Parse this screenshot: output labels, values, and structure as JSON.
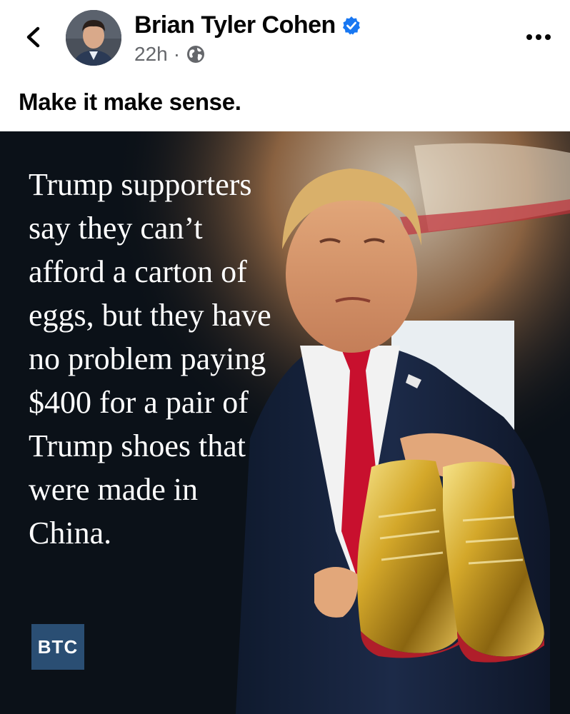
{
  "header": {
    "author_name": "Brian Tyler Cohen",
    "timestamp": "22h",
    "separator": "·",
    "verified": true,
    "audience_icon": "globe-icon",
    "back_icon": "chevron-left-icon",
    "more_icon": "more-horizontal-icon"
  },
  "post": {
    "caption": "Make it make sense.",
    "image": {
      "overlay_text": "Trump supporters\nsay they can’t\nafford a carton of\neggs, but they have\nno problem paying\n$400 for a pair of\nTrump shoes that\nwere made in\nChina.",
      "logo_text": "BTC",
      "description_elements": [
        "man-in-suit",
        "red-tie",
        "gold-sneakers"
      ]
    }
  },
  "colors": {
    "verified_blue": "#1877f2",
    "meta_gray": "#65676b",
    "logo_bg": "#2a4e73",
    "tie_red": "#c8102e",
    "shoe_gold": "#d4a82a"
  }
}
